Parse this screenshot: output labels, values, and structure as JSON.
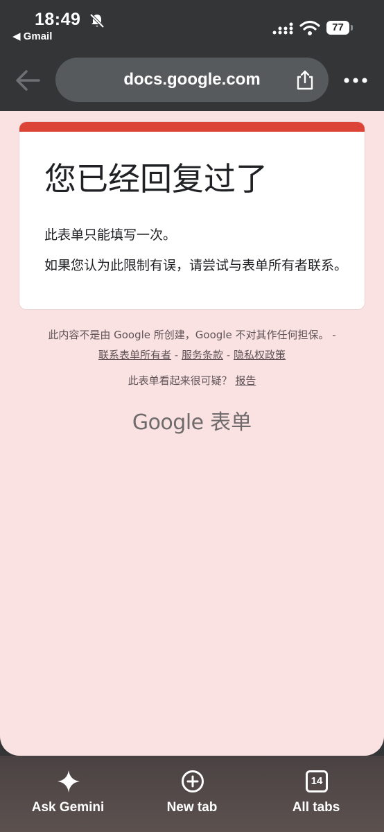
{
  "status_bar": {
    "time": "18:49",
    "back_app": "◀ Gmail",
    "battery": "77"
  },
  "toolbar": {
    "url": "docs.google.com"
  },
  "card": {
    "title": "您已经回复过了",
    "line1": "此表单只能填写一次。",
    "line2": "如果您认为此限制有误，请尝试与表单所有者联系。"
  },
  "footer": {
    "disclaimer_text": "此内容不是由 Google 所创建，Google 不对其作任何担保。 -",
    "contact_owner_link": "联系表单所有者",
    "sep1": " - ",
    "terms_link": "服务条款",
    "sep2": " - ",
    "privacy_link": "隐私权政策",
    "report_prompt": "此表单看起来很可疑？",
    "report_link": "报告",
    "brand_google": "Google",
    "brand_forms": "表单"
  },
  "bottom_bar": {
    "ask_gemini": "Ask Gemini",
    "new_tab": "New tab",
    "all_tabs": "All tabs",
    "tab_count": "14"
  },
  "colors": {
    "accent": "#db4437",
    "page_bg": "#fbe2e2",
    "chrome_bg": "#333536"
  }
}
